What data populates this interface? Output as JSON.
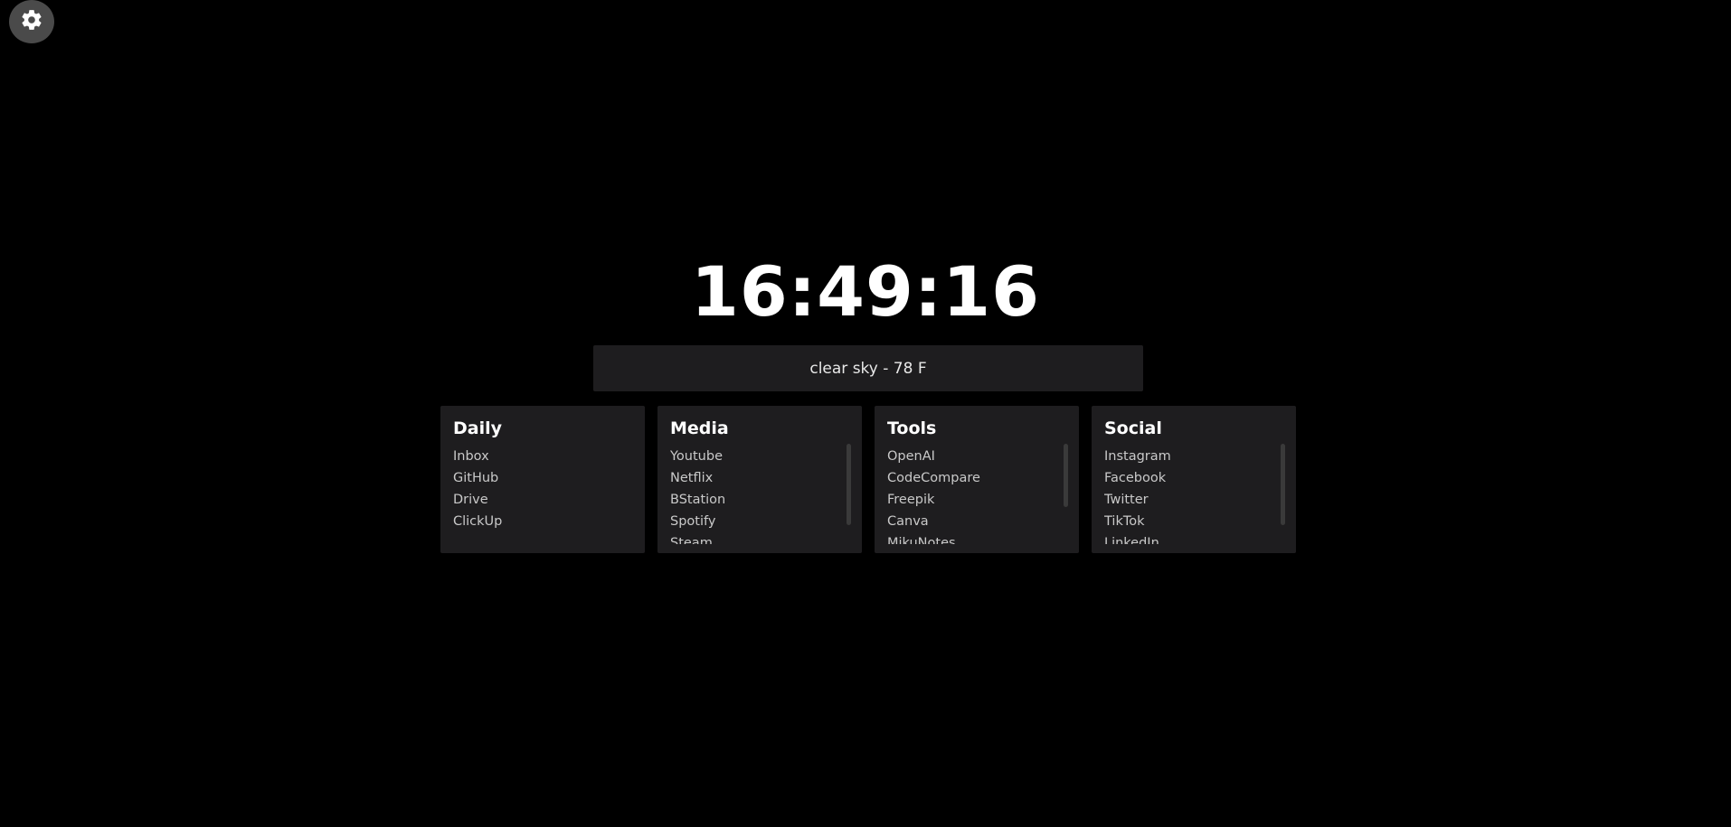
{
  "settings": {
    "icon": "gear-icon"
  },
  "clock": {
    "time": "16:49:16"
  },
  "weather": {
    "text": "clear sky - 78 F"
  },
  "cards": [
    {
      "title": "Daily",
      "items": [
        "Inbox",
        "GitHub",
        "Drive",
        "ClickUp"
      ],
      "scrollable": false
    },
    {
      "title": "Media",
      "items": [
        "Youtube",
        "Netflix",
        "BStation",
        "Spotify",
        "Steam"
      ],
      "scrollable": true,
      "scroll_fraction": 0.9
    },
    {
      "title": "Tools",
      "items": [
        "OpenAI",
        "CodeCompare",
        "Freepik",
        "Canva",
        "MikuNotes"
      ],
      "scrollable": true,
      "scroll_fraction": 0.7
    },
    {
      "title": "Social",
      "items": [
        "Instagram",
        "Facebook",
        "Twitter",
        "TikTok",
        "LinkedIn"
      ],
      "scrollable": true,
      "scroll_fraction": 0.9
    }
  ],
  "colors": {
    "background": "#000000",
    "panel": "#1e1d1f",
    "settings_button": "#4a4a4a",
    "text": "#ffffff",
    "link": "#c9c9c9"
  }
}
